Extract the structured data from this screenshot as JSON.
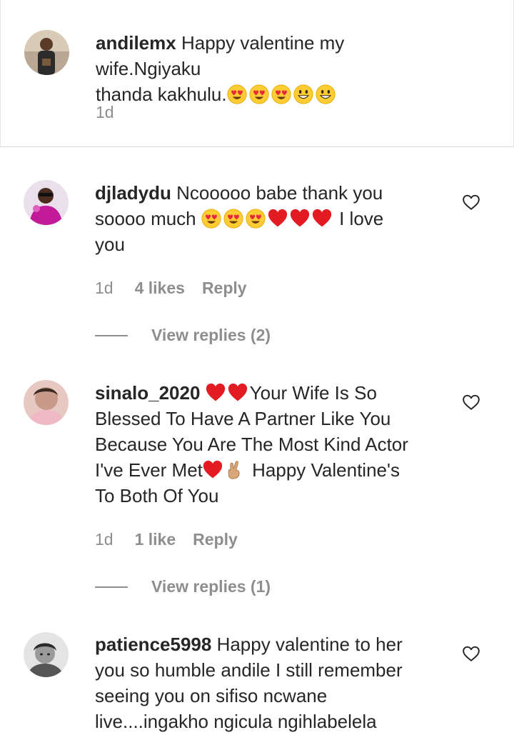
{
  "caption": {
    "username": "andilemx",
    "text_line1": "Happy valentine my wife.Ngiyaku",
    "text_line2": "thanda kakhulu.",
    "time": "1d"
  },
  "comments": [
    {
      "username": "djladydu",
      "text_part1": "Ncooooo babe thank you",
      "text_part2": "soooo much ",
      "text_part3": " I love",
      "text_part4": "you",
      "time": "1d",
      "likes": "4 likes",
      "reply": "Reply",
      "view_replies": "View replies (2)"
    },
    {
      "username": "sinalo_2020",
      "text_part1": "Your Wife Is So",
      "text_part2": "Blessed To Have A Partner Like You",
      "text_part3": "Because You Are The Most Kind Actor",
      "text_part4": "I've Ever Met",
      "text_part5": " Happy Valentine's",
      "text_part6": "To Both Of You",
      "time": "1d",
      "likes": "1 like",
      "reply": "Reply",
      "view_replies": "View replies (1)"
    },
    {
      "username": "patience5998",
      "text_part1": "Happy valentine to her",
      "text_part2": "you so humble andile I still remember",
      "text_part3": "seeing you on sifiso ncwane",
      "text_part4": "live....ingakho ngicula ngihlabelela"
    }
  ],
  "icons": {
    "like": "heart-outline-icon",
    "heart_eyes": "heart-eyes-emoji",
    "grin": "grinning-emoji",
    "red_heart": "red-heart-emoji",
    "fingers_crossed": "crossed-fingers-emoji"
  },
  "colors": {
    "text": "#262626",
    "secondary": "#8e8e8e",
    "divider": "#dbdbdb",
    "heart_red": "#ed1c24",
    "emoji_yellow": "#ffcc33"
  }
}
